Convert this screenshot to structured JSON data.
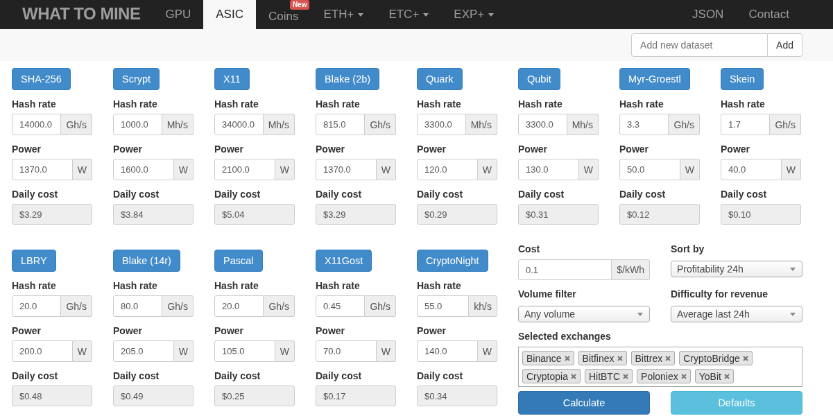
{
  "navbar": {
    "brand": "WHAT TO MINE",
    "items": [
      {
        "label": "GPU",
        "kind": "link",
        "selected": false
      },
      {
        "label": "ASIC",
        "kind": "link",
        "selected": true
      },
      {
        "label": "Coins",
        "kind": "link",
        "selected": false,
        "badge": "New"
      },
      {
        "label": "ETH+",
        "kind": "dropdown",
        "selected": false
      },
      {
        "label": "ETC+",
        "kind": "dropdown",
        "selected": false
      },
      {
        "label": "EXP+",
        "kind": "dropdown",
        "selected": false
      }
    ],
    "right_items": [
      {
        "label": "JSON"
      },
      {
        "label": "Contact"
      }
    ]
  },
  "dataset": {
    "placeholder": "Add new dataset",
    "button": "Add"
  },
  "algorithms": [
    {
      "name": "SHA-256",
      "hash_label": "Hash rate",
      "hash_rate": "14000.0",
      "hash_unit": "Gh/s",
      "power_label": "Power",
      "power": "1370.0",
      "power_unit": "W",
      "cost_label": "Daily cost",
      "daily_cost": "$3.29"
    },
    {
      "name": "Scrypt",
      "hash_label": "Hash rate",
      "hash_rate": "1000.0",
      "hash_unit": "Mh/s",
      "power_label": "Power",
      "power": "1600.0",
      "power_unit": "W",
      "cost_label": "Daily cost",
      "daily_cost": "$3.84"
    },
    {
      "name": "X11",
      "hash_label": "Hash rate",
      "hash_rate": "34000.0",
      "hash_unit": "Mh/s",
      "power_label": "Power",
      "power": "2100.0",
      "power_unit": "W",
      "cost_label": "Daily cost",
      "daily_cost": "$5.04"
    },
    {
      "name": "Blake (2b)",
      "hash_label": "Hash rate",
      "hash_rate": "815.0",
      "hash_unit": "Gh/s",
      "power_label": "Power",
      "power": "1370.0",
      "power_unit": "W",
      "cost_label": "Daily cost",
      "daily_cost": "$3.29"
    },
    {
      "name": "Quark",
      "hash_label": "Hash rate",
      "hash_rate": "3300.0",
      "hash_unit": "Mh/s",
      "power_label": "Power",
      "power": "120.0",
      "power_unit": "W",
      "cost_label": "Daily cost",
      "daily_cost": "$0.29"
    },
    {
      "name": "Qubit",
      "hash_label": "Hash rate",
      "hash_rate": "3300.0",
      "hash_unit": "Mh/s",
      "power_label": "Power",
      "power": "130.0",
      "power_unit": "W",
      "cost_label": "Daily cost",
      "daily_cost": "$0.31"
    },
    {
      "name": "Myr-Groestl",
      "hash_label": "Hash rate",
      "hash_rate": "3.3",
      "hash_unit": "Gh/s",
      "power_label": "Power",
      "power": "50.0",
      "power_unit": "W",
      "cost_label": "Daily cost",
      "daily_cost": "$0.12"
    },
    {
      "name": "Skein",
      "hash_label": "Hash rate",
      "hash_rate": "1.7",
      "hash_unit": "Gh/s",
      "power_label": "Power",
      "power": "40.0",
      "power_unit": "W",
      "cost_label": "Daily cost",
      "daily_cost": "$0.10"
    },
    {
      "name": "LBRY",
      "hash_label": "Hash rate",
      "hash_rate": "20.0",
      "hash_unit": "Gh/s",
      "power_label": "Power",
      "power": "200.0",
      "power_unit": "W",
      "cost_label": "Daily cost",
      "daily_cost": "$0.48"
    },
    {
      "name": "Blake (14r)",
      "hash_label": "Hash rate",
      "hash_rate": "80.0",
      "hash_unit": "Gh/s",
      "power_label": "Power",
      "power": "205.0",
      "power_unit": "W",
      "cost_label": "Daily cost",
      "daily_cost": "$0.49"
    },
    {
      "name": "Pascal",
      "hash_label": "Hash rate",
      "hash_rate": "20.0",
      "hash_unit": "Gh/s",
      "power_label": "Power",
      "power": "105.0",
      "power_unit": "W",
      "cost_label": "Daily cost",
      "daily_cost": "$0.25"
    },
    {
      "name": "X11Gost",
      "hash_label": "Hash rate",
      "hash_rate": "0.45",
      "hash_unit": "Gh/s",
      "power_label": "Power",
      "power": "70.0",
      "power_unit": "W",
      "cost_label": "Daily cost",
      "daily_cost": "$0.17"
    },
    {
      "name": "CryptoNight",
      "hash_label": "Hash rate",
      "hash_rate": "55.0",
      "hash_unit": "kh/s",
      "power_label": "Power",
      "power": "140.0",
      "power_unit": "W",
      "cost_label": "Daily cost",
      "daily_cost": "$0.34"
    }
  ],
  "settings": {
    "cost": {
      "label": "Cost",
      "value": "0.1",
      "unit": "$/kWh"
    },
    "sort_by": {
      "label": "Sort by",
      "value": "Profitability 24h"
    },
    "volume_filter": {
      "label": "Volume filter",
      "value": "Any volume"
    },
    "difficulty": {
      "label": "Difficulty for revenue",
      "value": "Average last 24h"
    },
    "exchanges": {
      "label": "Selected exchanges",
      "tags": [
        "Binance",
        "Bitfinex",
        "Bittrex",
        "CryptoBridge",
        "Cryptopia",
        "HitBTC",
        "Poloniex",
        "YoBit"
      ]
    },
    "buttons": [
      {
        "label": "Calculate",
        "kind": "primary"
      },
      {
        "label": "Defaults",
        "kind": "info"
      }
    ]
  }
}
